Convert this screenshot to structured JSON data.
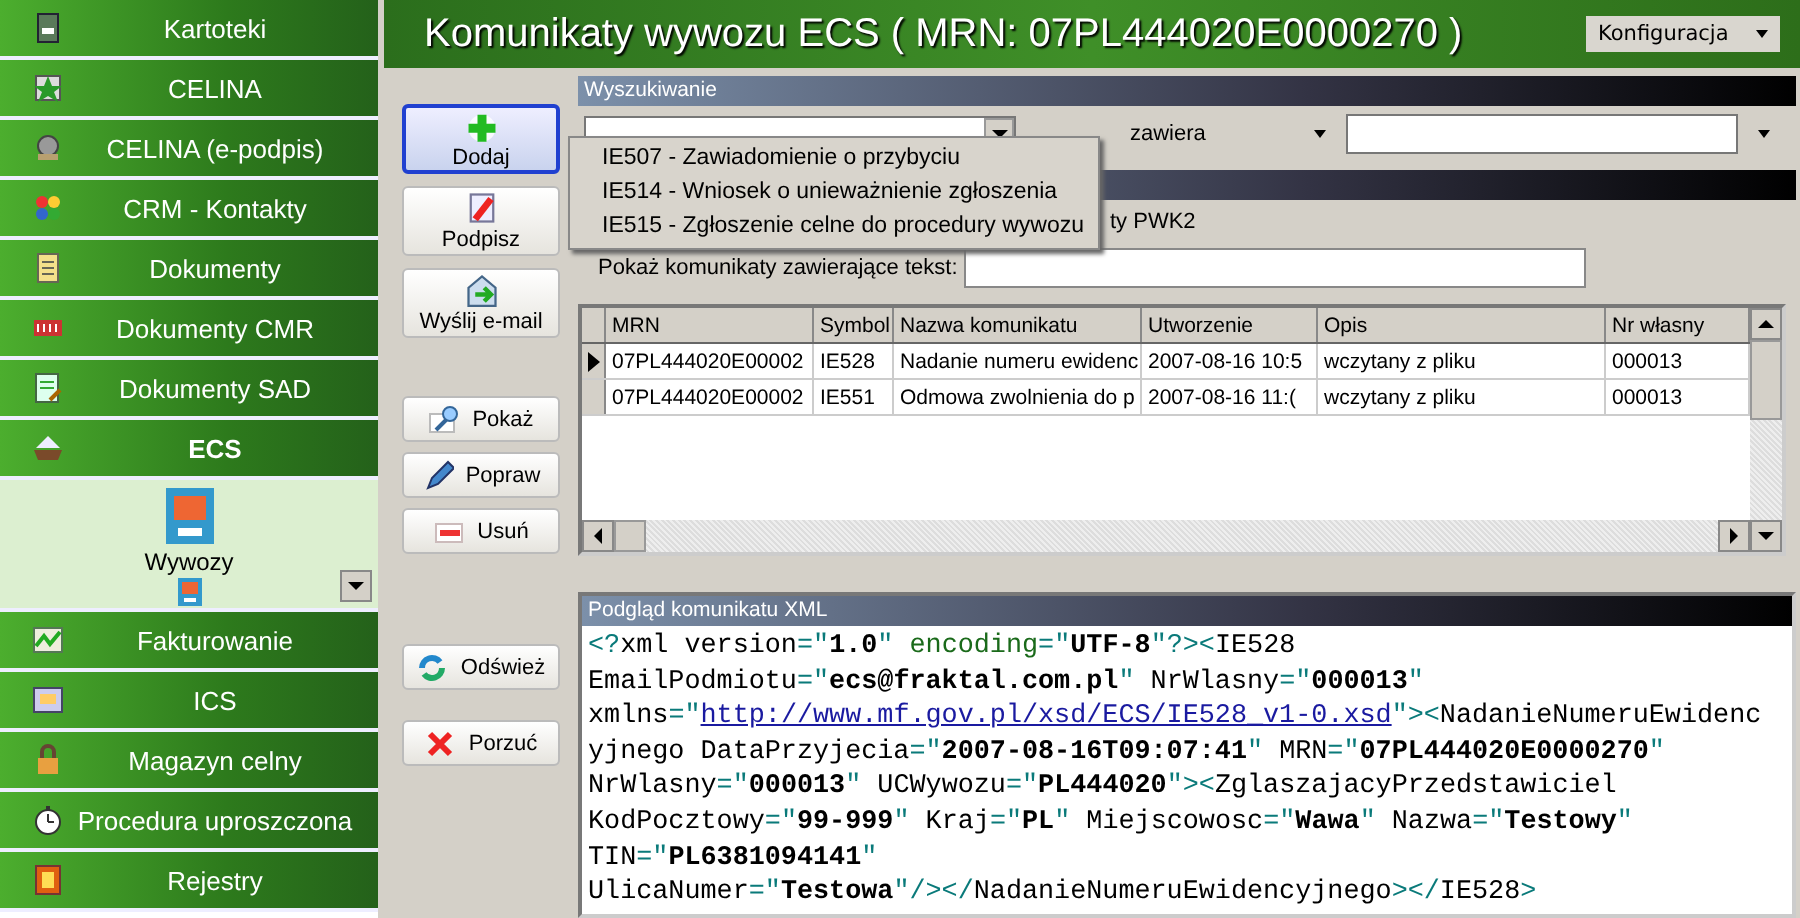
{
  "sidebar": {
    "items": [
      {
        "label": "Kartoteki",
        "selected": false
      },
      {
        "label": "CELINA",
        "selected": false
      },
      {
        "label": "CELINA (e-podpis)",
        "selected": false
      },
      {
        "label": "CRM - Kontakty",
        "selected": false
      },
      {
        "label": "Dokumenty",
        "selected": false
      },
      {
        "label": "Dokumenty CMR",
        "selected": false
      },
      {
        "label": "Dokumenty SAD",
        "selected": false
      },
      {
        "label": "ECS",
        "selected": true,
        "expanded": true,
        "children": [
          {
            "label": "Wywozy"
          }
        ]
      },
      {
        "label": "Fakturowanie",
        "selected": false
      },
      {
        "label": "ICS",
        "selected": false
      },
      {
        "label": "Magazyn celny",
        "selected": false
      },
      {
        "label": "Procedura uproszczona",
        "selected": false
      },
      {
        "label": "Rejestry",
        "selected": false
      }
    ]
  },
  "header": {
    "title": "Komunikaty wywozu ECS ( MRN: 07PL444020E0000270 )",
    "menu_button": "Konfiguracja"
  },
  "toolbar": [
    {
      "label": "Dodaj",
      "focused": true
    },
    {
      "label": "Podpisz",
      "focused": false
    },
    {
      "label": "Wyślij e-mail",
      "focused": false
    },
    {
      "label": "Pokaż",
      "focused": false
    },
    {
      "label": "Popraw",
      "focused": false
    },
    {
      "label": "Usuń",
      "focused": false
    },
    {
      "label": "Odśwież",
      "focused": false
    },
    {
      "label": "Porzuć",
      "focused": false
    }
  ],
  "search": {
    "title": "Wyszukiwanie",
    "operator": "zawiera",
    "partial_label": "ty PWK2",
    "text_label": "Pokaż komunikaty zawierające tekst:"
  },
  "add_menu": {
    "items": [
      "IE507 - Zawiadomienie o przybyciu",
      "IE514 - Wniosek o unieważnienie zgłoszenia",
      "IE515 - Zgłoszenie celne do procedury wywozu"
    ]
  },
  "table": {
    "columns": [
      "MRN",
      "Symbol",
      "Nazwa komunikatu",
      "Utworzenie",
      "Opis",
      "Nr własny"
    ],
    "rows": [
      {
        "selected": true,
        "cells": [
          "07PL444020E00002",
          "IE528",
          "Nadanie numeru ewidenc",
          "2007-08-16 10:5",
          "wczytany z pliku",
          "000013"
        ]
      },
      {
        "selected": false,
        "cells": [
          "07PL444020E00002",
          "IE551",
          "Odmowa zwolnienia do p",
          "2007-08-16 11:(",
          "wczytany z pliku",
          "000013"
        ]
      }
    ]
  },
  "xml_preview": {
    "title": "Podgląd komunikatu XML",
    "lines": [
      [
        {
          "kind": "punct",
          "text": "<?"
        },
        {
          "kind": "name",
          "text": "xml version"
        },
        {
          "kind": "punct",
          "text": "=\""
        },
        {
          "kind": "value",
          "text": "1.0"
        },
        {
          "kind": "punct",
          "text": "\" "
        },
        {
          "kind": "pi",
          "text": "encoding"
        },
        {
          "kind": "punct",
          "text": "=\""
        },
        {
          "kind": "value",
          "text": "UTF-8"
        },
        {
          "kind": "punct",
          "text": "\"?><"
        },
        {
          "kind": "name",
          "text": "IE528"
        }
      ],
      [
        {
          "kind": "name",
          "text": "EmailPodmiotu"
        },
        {
          "kind": "punct",
          "text": "=\""
        },
        {
          "kind": "value",
          "text": "ecs@fraktal.com.pl"
        },
        {
          "kind": "punct",
          "text": "\" "
        },
        {
          "kind": "name",
          "text": "NrWlasny"
        },
        {
          "kind": "punct",
          "text": "=\""
        },
        {
          "kind": "value",
          "text": "000013"
        },
        {
          "kind": "punct",
          "text": "\""
        }
      ],
      [
        {
          "kind": "name",
          "text": "xmlns"
        },
        {
          "kind": "punct",
          "text": "=\""
        },
        {
          "kind": "link",
          "text": "http://www.mf.gov.pl/xsd/ECS/IE528_v1-0.xsd"
        },
        {
          "kind": "punct",
          "text": "\"><"
        },
        {
          "kind": "name",
          "text": "NadanieNumeruEwidenc"
        }
      ],
      [
        {
          "kind": "name",
          "text": "yjnego DataPrzyjecia"
        },
        {
          "kind": "punct",
          "text": "=\""
        },
        {
          "kind": "value",
          "text": "2007-08-16T09:07:41"
        },
        {
          "kind": "punct",
          "text": "\" "
        },
        {
          "kind": "name",
          "text": "MRN"
        },
        {
          "kind": "punct",
          "text": "=\""
        },
        {
          "kind": "value",
          "text": "07PL444020E0000270"
        },
        {
          "kind": "punct",
          "text": "\""
        }
      ],
      [
        {
          "kind": "name",
          "text": "NrWlasny"
        },
        {
          "kind": "punct",
          "text": "=\""
        },
        {
          "kind": "value",
          "text": "000013"
        },
        {
          "kind": "punct",
          "text": "\" "
        },
        {
          "kind": "name",
          "text": "UCWywozu"
        },
        {
          "kind": "punct",
          "text": "=\""
        },
        {
          "kind": "value",
          "text": "PL444020"
        },
        {
          "kind": "punct",
          "text": "\"><"
        },
        {
          "kind": "name",
          "text": "ZglaszajacyPrzedstawiciel"
        }
      ],
      [
        {
          "kind": "name",
          "text": "KodPocztowy"
        },
        {
          "kind": "punct",
          "text": "=\""
        },
        {
          "kind": "value",
          "text": "99-999"
        },
        {
          "kind": "punct",
          "text": "\" "
        },
        {
          "kind": "name",
          "text": "Kraj"
        },
        {
          "kind": "punct",
          "text": "=\""
        },
        {
          "kind": "value",
          "text": "PL"
        },
        {
          "kind": "punct",
          "text": "\" "
        },
        {
          "kind": "name",
          "text": "Miejscowosc"
        },
        {
          "kind": "punct",
          "text": "=\""
        },
        {
          "kind": "value",
          "text": "Wawa"
        },
        {
          "kind": "punct",
          "text": "\" "
        },
        {
          "kind": "name",
          "text": "Nazwa"
        },
        {
          "kind": "punct",
          "text": "=\""
        },
        {
          "kind": "value",
          "text": "Testowy"
        },
        {
          "kind": "punct",
          "text": "\""
        }
      ],
      [
        {
          "kind": "name",
          "text": "TIN"
        },
        {
          "kind": "punct",
          "text": "=\""
        },
        {
          "kind": "value",
          "text": "PL6381094141"
        },
        {
          "kind": "punct",
          "text": "\""
        }
      ],
      [
        {
          "kind": "name",
          "text": "UlicaNumer"
        },
        {
          "kind": "punct",
          "text": "=\""
        },
        {
          "kind": "value",
          "text": "Testowa"
        },
        {
          "kind": "punct",
          "text": "\"/></"
        },
        {
          "kind": "name",
          "text": "NadanieNumeruEwidencyjnego"
        },
        {
          "kind": "punct",
          "text": "></"
        },
        {
          "kind": "name",
          "text": "IE528"
        },
        {
          "kind": "punct",
          "text": ">"
        }
      ]
    ]
  }
}
